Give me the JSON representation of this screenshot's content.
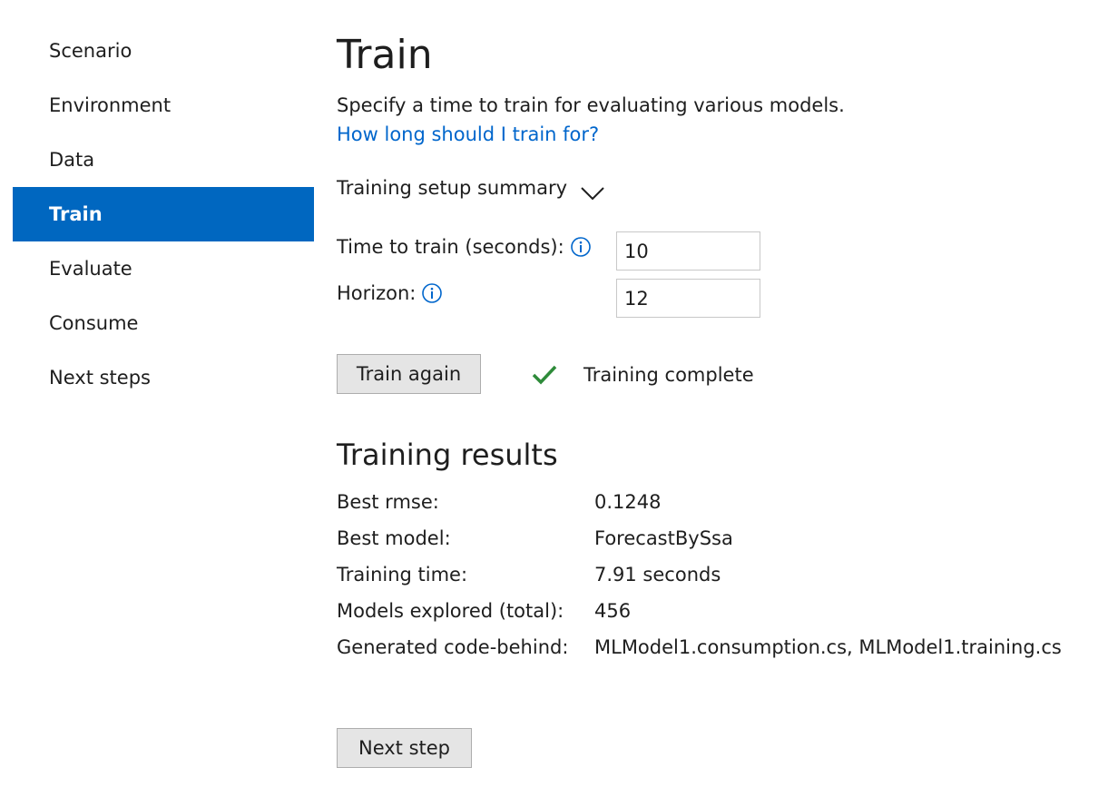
{
  "sidebar": {
    "items": [
      {
        "label": "Scenario"
      },
      {
        "label": "Environment"
      },
      {
        "label": "Data"
      },
      {
        "label": "Train"
      },
      {
        "label": "Evaluate"
      },
      {
        "label": "Consume"
      },
      {
        "label": "Next steps"
      }
    ],
    "active_item": "Train"
  },
  "main": {
    "title": "Train",
    "subtitle": "Specify a time to train for evaluating various models.",
    "help_link": "How long should I train for?",
    "summary_toggle": "Training setup summary",
    "fields": {
      "time_to_train": {
        "label": "Time to train (seconds):",
        "value": "10"
      },
      "horizon": {
        "label": "Horizon:",
        "value": "12"
      }
    },
    "train_again_button": "Train again",
    "status_text": "Training complete",
    "results": {
      "title": "Training results",
      "rows": [
        {
          "key": "Best rmse:",
          "value": "0.1248"
        },
        {
          "key": "Best model:",
          "value": "ForecastBySsa"
        },
        {
          "key": "Training time:",
          "value": "7.91 seconds"
        },
        {
          "key": "Models explored (total):",
          "value": "456"
        },
        {
          "key": "Generated code-behind:",
          "value": "MLModel1.consumption.cs, MLModel1.training.cs"
        }
      ]
    },
    "next_step_button": "Next step"
  },
  "colors": {
    "accent": "#0067c0",
    "link": "#0066cc",
    "success": "#2e8b3a",
    "button_bg": "#e5e5e5"
  },
  "icons": {
    "info": "info-icon",
    "chevron": "chevron-down-icon",
    "check": "check-icon"
  }
}
